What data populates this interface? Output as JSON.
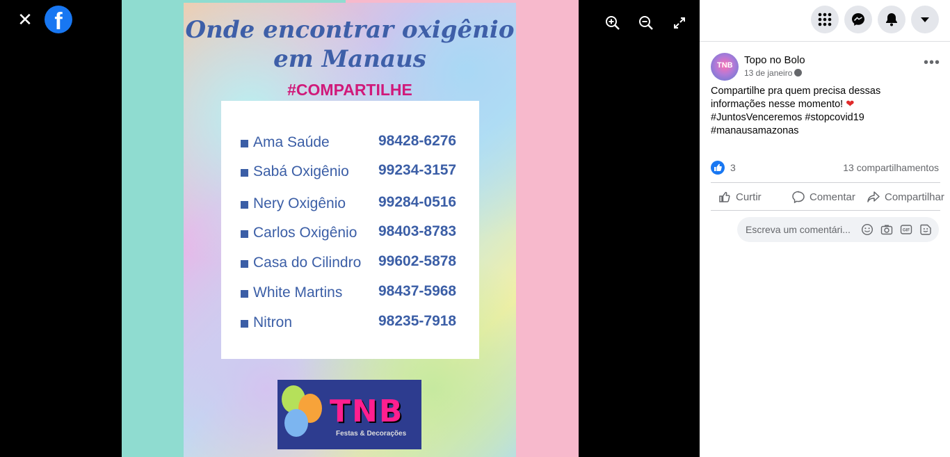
{
  "viewer": {
    "close_icon": "close-icon",
    "logo_letter": "f",
    "zoom_in_icon": "zoom-in-icon",
    "zoom_out_icon": "zoom-out-icon",
    "fullscreen_icon": "fullscreen-icon"
  },
  "photo": {
    "title_line1": "Onde encontrar oxigênio",
    "title_line2": "em Manaus",
    "share_tag": "#COMPARTILHE",
    "rows": [
      {
        "name": "Ama Saúde",
        "phone": "98428-6276"
      },
      {
        "name": "Sabá Oxigênio",
        "phone": "99234-3157"
      },
      {
        "name": "Nery Oxigênio",
        "phone": "99284-0516"
      },
      {
        "name": "Carlos Oxigênio",
        "phone": "98403-8783"
      },
      {
        "name": "Casa do Cilindro",
        "phone": "99602-5878"
      },
      {
        "name": "White Martins",
        "phone": "98437-5968"
      },
      {
        "name": "Nitron",
        "phone": "98235-7918"
      }
    ],
    "logo_text": "TNB",
    "logo_subtitle": "Festas & Decorações"
  },
  "panel": {
    "top_icons": [
      "apps-grid-icon",
      "messenger-icon",
      "notifications-icon",
      "account-dropdown-icon"
    ],
    "page_name": "Topo no Bolo",
    "post_date": "13 de janeiro",
    "post_text_line1": "Compartilhe pra quem precisa dessas",
    "post_text_line2": "informações nesse momento!",
    "hashtags_line1": "#JuntosVenceremos #stopcovid19",
    "hashtags_line2": "#manausamazonas",
    "like_count": "3",
    "share_count": "13 compartilhamentos",
    "actions": {
      "like": "Curtir",
      "comment": "Comentar",
      "share": "Compartilhar"
    },
    "comment_placeholder": "Escreva um comentári..."
  },
  "colors": {
    "fb_blue": "#1877f2",
    "card_text": "#3b5ea6",
    "share_pink": "#d0197a"
  }
}
